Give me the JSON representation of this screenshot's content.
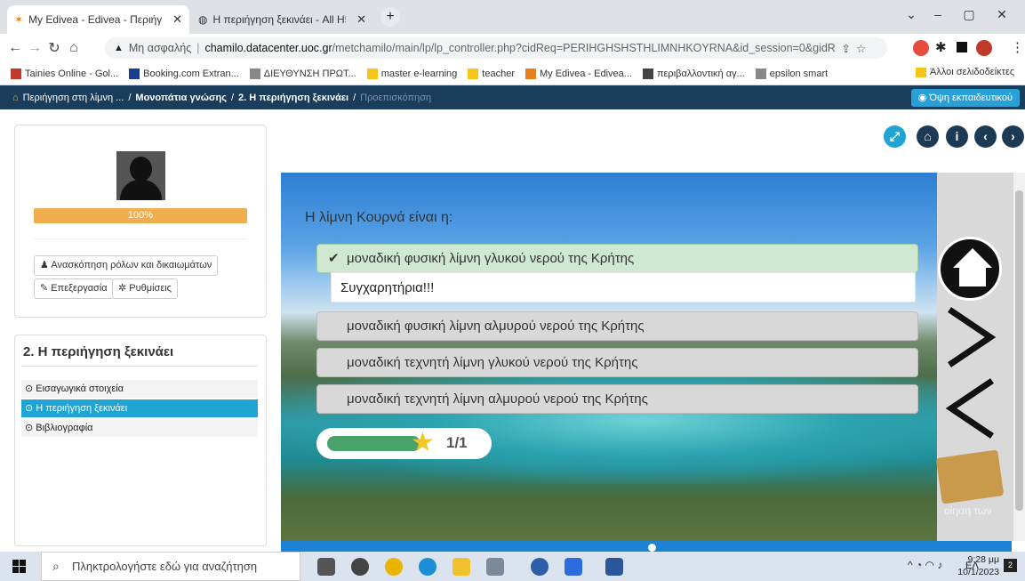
{
  "browser": {
    "tabs": [
      {
        "title": "My Edivea - Edivea - Περιήγηση",
        "active": true
      },
      {
        "title": "Η περιήγηση ξεκινάει - All H5P C",
        "active": false
      }
    ],
    "new_tab": "+",
    "window_controls": {
      "dropdown": "⌄",
      "minimize": "–",
      "maximize": "▢",
      "close": "✕"
    },
    "address": {
      "security": "Μη ασφαλής",
      "domain": "chamilo.datacenter.uoc.gr",
      "path": "/metchamilo/main/lp/lp_controller.php?cidReq=PERIHGHSHSTHLIMNHKOYRNA&id_session=0&gidReq=0&gr..."
    },
    "bookmarks": [
      {
        "label": "Tainies Online - Gol...",
        "color": "#c0392b"
      },
      {
        "label": "Booking.com Extran...",
        "color": "#1a3d8f"
      },
      {
        "label": "ΔΙΕΥΘΥΝΣΗ ΠΡΩΤ...",
        "color": "#888"
      },
      {
        "label": "master e-learning",
        "color": "#f5c518"
      },
      {
        "label": "teacher",
        "color": "#f5c518"
      },
      {
        "label": "My Edivea - Edivea...",
        "color": "#e67e22"
      },
      {
        "label": "περιβαλλοντική αγ...",
        "color": "#444"
      },
      {
        "label": "epsilon smart",
        "color": "#888"
      }
    ],
    "other_bookmarks": "Άλλοι σελιδοδείκτες"
  },
  "breadcrumb": {
    "items": [
      "Περιήγηση στη λίμνη ...",
      "Μονοπάτια γνώσης",
      "2. Η περιήγηση ξεκινάει"
    ],
    "current": "Προεπισκόπηση",
    "separator": "/",
    "teacher_view": "Όψη εκπαιδευτικού"
  },
  "sidebar": {
    "progress": 100,
    "progress_label": "100%",
    "roles_button": "Ανασκόπηση ρόλων και δικαιωμάτων",
    "edit_button": "Επεξεργασία",
    "settings_button": "Ρυθμίσεις",
    "section_title": "2. Η περιήγηση ξεκινάει",
    "items": [
      {
        "label": "Εισαγωγικά στοιχεία",
        "selected": false
      },
      {
        "label": "Η περιήγηση ξεκινάει",
        "selected": true
      },
      {
        "label": "Βιβλιογραφία",
        "selected": false
      }
    ]
  },
  "quiz": {
    "question": "Η λίμνη Κουρνά είναι η:",
    "answers": [
      {
        "text": "μοναδική φυσική λίμνη γλυκού νερού της Κρήτης",
        "correct": true
      },
      {
        "text": "μοναδική φυσική λίμνη αλμυρού νερού της Κρήτης",
        "correct": false
      },
      {
        "text": "μοναδική τεχνητή λίμνη γλυκού νερού της Κρήτης",
        "correct": false
      },
      {
        "text": "μοναδική τεχνητή λίμνη αλμυρού νερού της Κρήτης",
        "correct": false
      }
    ],
    "feedback": "Συγχαρητήρια!!!",
    "score": "1/1",
    "score_fraction": 1.0,
    "overlay_text": "οίηση των"
  },
  "taskbar": {
    "search_placeholder": "Πληκτρολογήστε εδώ για αναζήτηση",
    "lang": "ΕΛ",
    "time": "9:28 μμ",
    "date": "10/1/2023",
    "notifications": "2"
  }
}
